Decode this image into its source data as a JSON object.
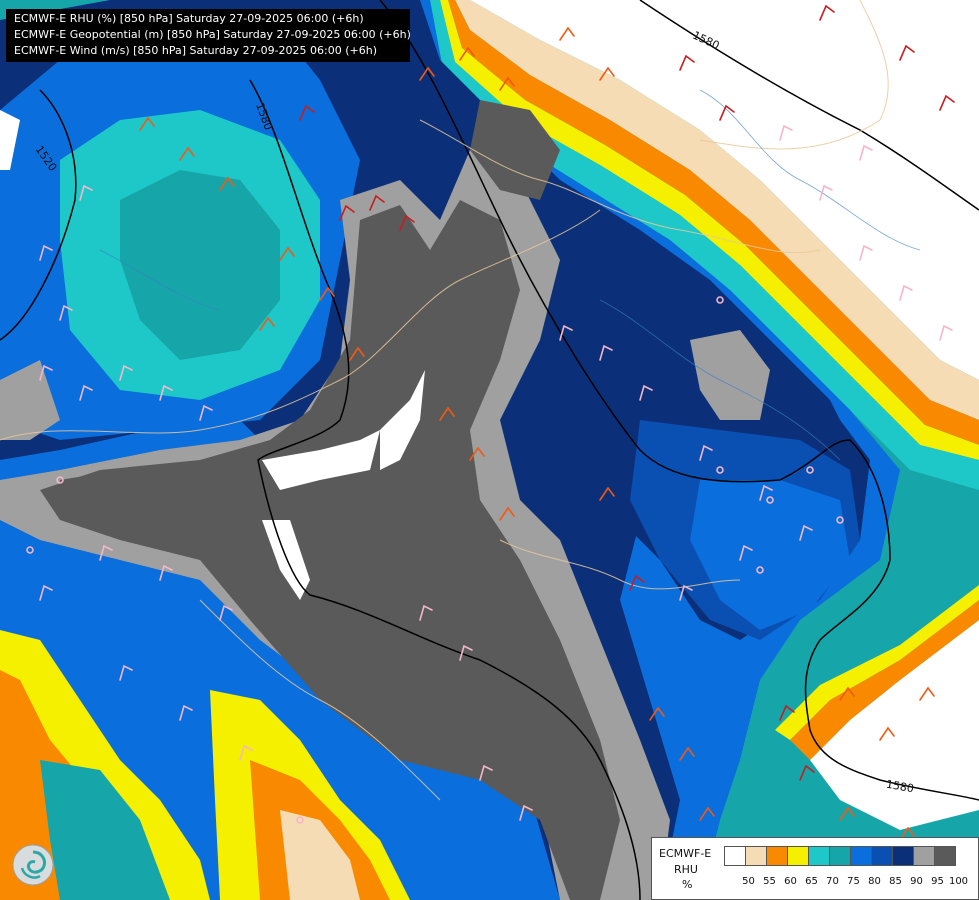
{
  "header": {
    "lines": [
      "ECMWF-E RHU (%) [850 hPa] Saturday 27-09-2025 06:00 (+6h)",
      "ECMWF-E Geopotential (m) [850 hPa] Saturday 27-09-2025 06:00 (+6h)",
      "ECMWF-E Wind (m/s) [850 hPa] Saturday 27-09-2025 06:00 (+6h)"
    ]
  },
  "legend": {
    "model": "ECMWF-E",
    "variable": "RHU",
    "unit": "%",
    "colors": [
      "#ffffff",
      "#f5dcb4",
      "#f98a00",
      "#f5f000",
      "#1ec8c8",
      "#16a5a8",
      "#0a6edc",
      "#0a4fb2",
      "#0b2f78",
      "#a0a0a0",
      "#5a5a5a"
    ],
    "ticks": [
      "50",
      "55",
      "60",
      "65",
      "70",
      "75",
      "80",
      "85",
      "90",
      "95",
      "100"
    ]
  },
  "contours": {
    "labels": [
      "1520",
      "1580",
      "1580",
      "1580",
      "1520",
      "1580"
    ]
  },
  "logo": {
    "icon": "ecmwf-swirl-logo"
  }
}
